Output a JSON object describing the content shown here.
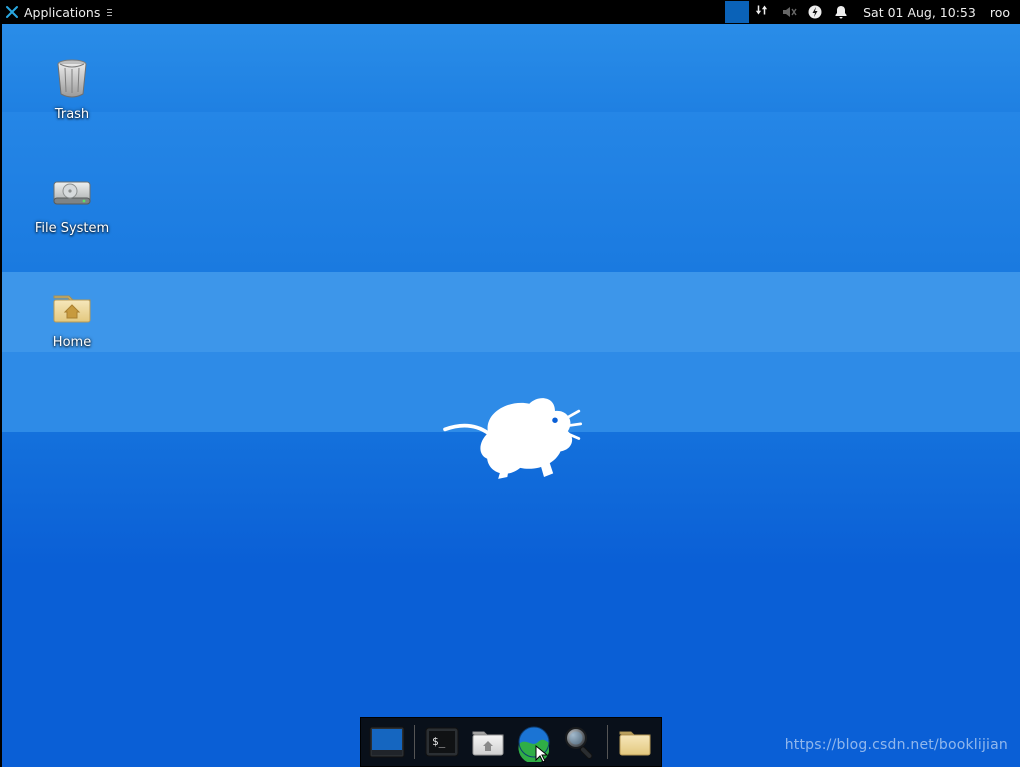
{
  "panel": {
    "applications_label": "Applications",
    "clock": "Sat 01 Aug, 10:53",
    "user": "roo"
  },
  "desktop_icons": {
    "trash": "Trash",
    "filesystem": "File System",
    "home": "Home"
  },
  "dock": {
    "items": [
      "show-desktop",
      "terminal",
      "file-manager",
      "web-browser",
      "app-finder",
      "home-folder"
    ]
  },
  "watermark": "https://blog.csdn.net/booklijian"
}
